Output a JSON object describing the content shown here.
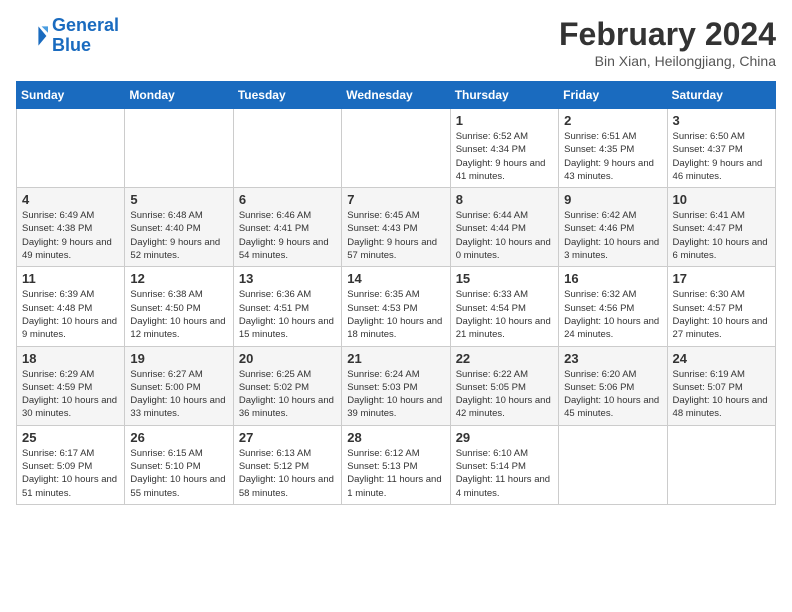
{
  "header": {
    "logo_line1": "General",
    "logo_line2": "Blue",
    "month_year": "February 2024",
    "location": "Bin Xian, Heilongjiang, China"
  },
  "weekdays": [
    "Sunday",
    "Monday",
    "Tuesday",
    "Wednesday",
    "Thursday",
    "Friday",
    "Saturday"
  ],
  "weeks": [
    [
      {
        "date": "",
        "info": ""
      },
      {
        "date": "",
        "info": ""
      },
      {
        "date": "",
        "info": ""
      },
      {
        "date": "",
        "info": ""
      },
      {
        "date": "1",
        "info": "Sunrise: 6:52 AM\nSunset: 4:34 PM\nDaylight: 9 hours and 41 minutes."
      },
      {
        "date": "2",
        "info": "Sunrise: 6:51 AM\nSunset: 4:35 PM\nDaylight: 9 hours and 43 minutes."
      },
      {
        "date": "3",
        "info": "Sunrise: 6:50 AM\nSunset: 4:37 PM\nDaylight: 9 hours and 46 minutes."
      }
    ],
    [
      {
        "date": "4",
        "info": "Sunrise: 6:49 AM\nSunset: 4:38 PM\nDaylight: 9 hours and 49 minutes."
      },
      {
        "date": "5",
        "info": "Sunrise: 6:48 AM\nSunset: 4:40 PM\nDaylight: 9 hours and 52 minutes."
      },
      {
        "date": "6",
        "info": "Sunrise: 6:46 AM\nSunset: 4:41 PM\nDaylight: 9 hours and 54 minutes."
      },
      {
        "date": "7",
        "info": "Sunrise: 6:45 AM\nSunset: 4:43 PM\nDaylight: 9 hours and 57 minutes."
      },
      {
        "date": "8",
        "info": "Sunrise: 6:44 AM\nSunset: 4:44 PM\nDaylight: 10 hours and 0 minutes."
      },
      {
        "date": "9",
        "info": "Sunrise: 6:42 AM\nSunset: 4:46 PM\nDaylight: 10 hours and 3 minutes."
      },
      {
        "date": "10",
        "info": "Sunrise: 6:41 AM\nSunset: 4:47 PM\nDaylight: 10 hours and 6 minutes."
      }
    ],
    [
      {
        "date": "11",
        "info": "Sunrise: 6:39 AM\nSunset: 4:48 PM\nDaylight: 10 hours and 9 minutes."
      },
      {
        "date": "12",
        "info": "Sunrise: 6:38 AM\nSunset: 4:50 PM\nDaylight: 10 hours and 12 minutes."
      },
      {
        "date": "13",
        "info": "Sunrise: 6:36 AM\nSunset: 4:51 PM\nDaylight: 10 hours and 15 minutes."
      },
      {
        "date": "14",
        "info": "Sunrise: 6:35 AM\nSunset: 4:53 PM\nDaylight: 10 hours and 18 minutes."
      },
      {
        "date": "15",
        "info": "Sunrise: 6:33 AM\nSunset: 4:54 PM\nDaylight: 10 hours and 21 minutes."
      },
      {
        "date": "16",
        "info": "Sunrise: 6:32 AM\nSunset: 4:56 PM\nDaylight: 10 hours and 24 minutes."
      },
      {
        "date": "17",
        "info": "Sunrise: 6:30 AM\nSunset: 4:57 PM\nDaylight: 10 hours and 27 minutes."
      }
    ],
    [
      {
        "date": "18",
        "info": "Sunrise: 6:29 AM\nSunset: 4:59 PM\nDaylight: 10 hours and 30 minutes."
      },
      {
        "date": "19",
        "info": "Sunrise: 6:27 AM\nSunset: 5:00 PM\nDaylight: 10 hours and 33 minutes."
      },
      {
        "date": "20",
        "info": "Sunrise: 6:25 AM\nSunset: 5:02 PM\nDaylight: 10 hours and 36 minutes."
      },
      {
        "date": "21",
        "info": "Sunrise: 6:24 AM\nSunset: 5:03 PM\nDaylight: 10 hours and 39 minutes."
      },
      {
        "date": "22",
        "info": "Sunrise: 6:22 AM\nSunset: 5:05 PM\nDaylight: 10 hours and 42 minutes."
      },
      {
        "date": "23",
        "info": "Sunrise: 6:20 AM\nSunset: 5:06 PM\nDaylight: 10 hours and 45 minutes."
      },
      {
        "date": "24",
        "info": "Sunrise: 6:19 AM\nSunset: 5:07 PM\nDaylight: 10 hours and 48 minutes."
      }
    ],
    [
      {
        "date": "25",
        "info": "Sunrise: 6:17 AM\nSunset: 5:09 PM\nDaylight: 10 hours and 51 minutes."
      },
      {
        "date": "26",
        "info": "Sunrise: 6:15 AM\nSunset: 5:10 PM\nDaylight: 10 hours and 55 minutes."
      },
      {
        "date": "27",
        "info": "Sunrise: 6:13 AM\nSunset: 5:12 PM\nDaylight: 10 hours and 58 minutes."
      },
      {
        "date": "28",
        "info": "Sunrise: 6:12 AM\nSunset: 5:13 PM\nDaylight: 11 hours and 1 minute."
      },
      {
        "date": "29",
        "info": "Sunrise: 6:10 AM\nSunset: 5:14 PM\nDaylight: 11 hours and 4 minutes."
      },
      {
        "date": "",
        "info": ""
      },
      {
        "date": "",
        "info": ""
      }
    ]
  ]
}
